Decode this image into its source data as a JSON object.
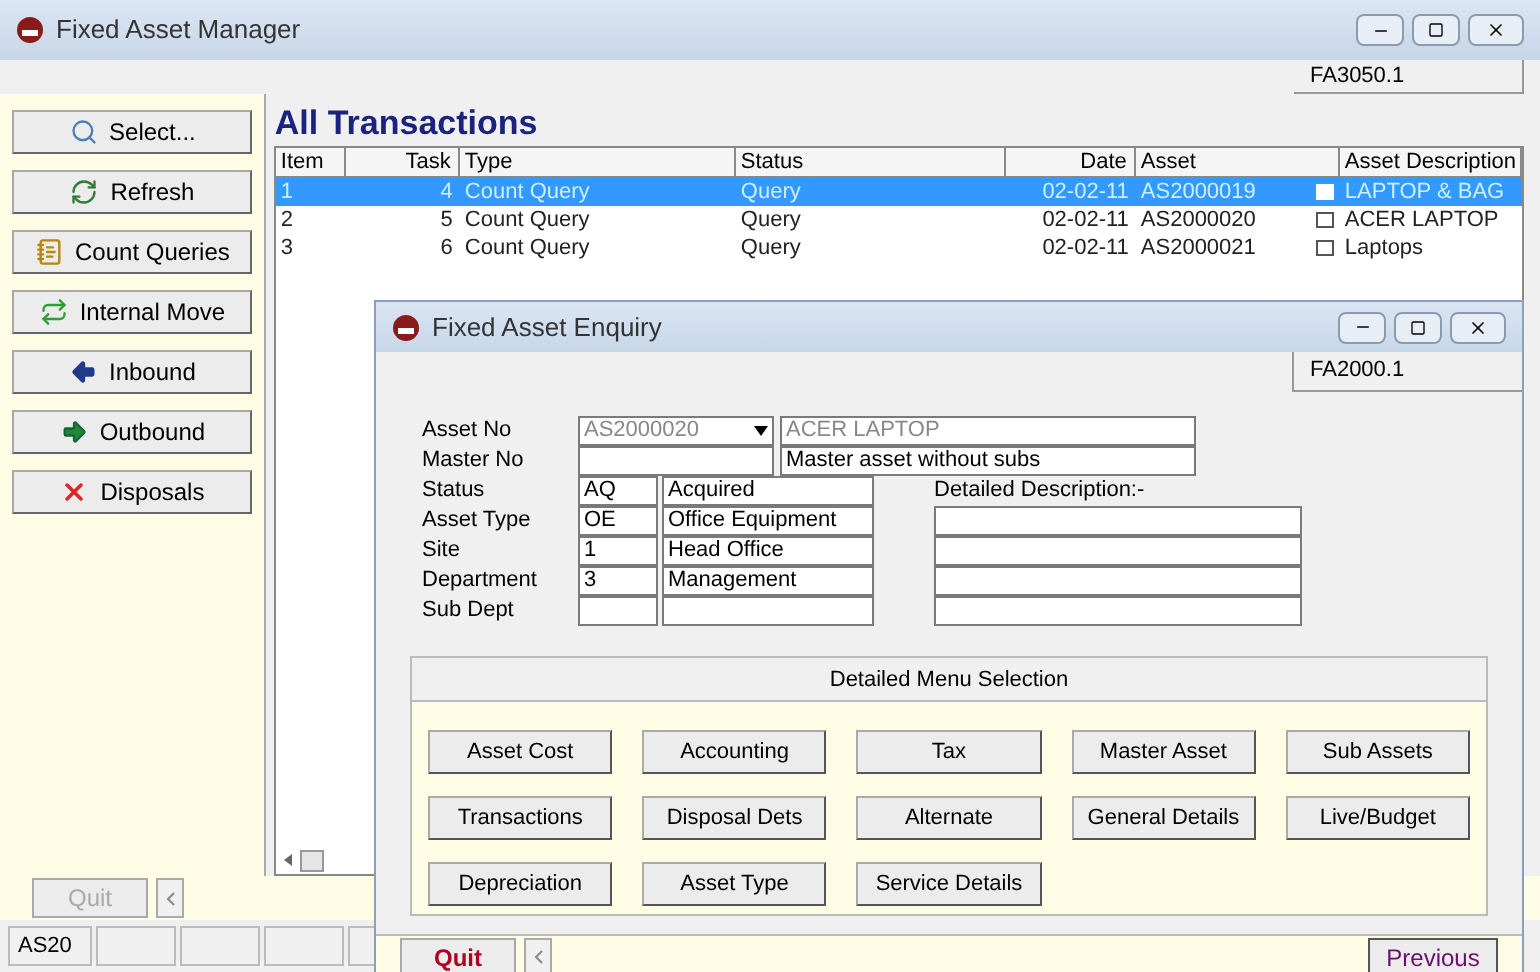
{
  "window": {
    "title": "Fixed Asset Manager",
    "code": "FA3050.1"
  },
  "sidebar": {
    "buttons": [
      {
        "label": "Select..."
      },
      {
        "label": "Refresh"
      },
      {
        "label": "Count Queries"
      },
      {
        "label": "Internal Move"
      },
      {
        "label": "Inbound"
      },
      {
        "label": "Outbound"
      },
      {
        "label": "Disposals"
      }
    ]
  },
  "heading": "All Transactions",
  "table": {
    "columns": [
      "Item",
      "Task",
      "Type",
      "Status",
      "Date",
      "Asset",
      "Asset Description"
    ],
    "rows": [
      {
        "item": "1",
        "task": "4",
        "type": "Count Query",
        "status": "Query",
        "date": "02-02-11",
        "asset": "AS2000019",
        "description": "LAPTOP & BAG",
        "selected": true
      },
      {
        "item": "2",
        "task": "5",
        "type": "Count Query",
        "status": "Query",
        "date": "02-02-11",
        "asset": "AS2000020",
        "description": "ACER LAPTOP",
        "selected": false
      },
      {
        "item": "3",
        "task": "6",
        "type": "Count Query",
        "status": "Query",
        "date": "02-02-11",
        "asset": "AS2000021",
        "description": "Laptops",
        "selected": false
      }
    ]
  },
  "bottom_bar": {
    "quit": {
      "label": "Quit",
      "disabled": true
    }
  },
  "status_bar": [
    "AS20"
  ],
  "dialog": {
    "title": "Fixed Asset Enquiry",
    "code": "FA2000.1",
    "asset_no": {
      "label": "Asset No",
      "value": "AS2000020",
      "description": "ACER LAPTOP"
    },
    "master_no": {
      "label": "Master No",
      "description": "Master asset without subs"
    },
    "fields": [
      {
        "label": "Status",
        "code": "AQ",
        "value": "Acquired"
      },
      {
        "label": "Asset Type",
        "code": "OE",
        "value": "Office Equipment"
      },
      {
        "label": "Site",
        "code": "1",
        "value": "Head Office"
      },
      {
        "label": "Department",
        "code": "3",
        "value": "Management"
      },
      {
        "label": "Sub Dept"
      }
    ],
    "detailed_description_label": "Detailed Description:-",
    "menu_title": "Detailed Menu Selection",
    "menu_buttons": [
      "Asset Cost",
      "Accounting",
      "Tax",
      "Master Asset",
      "Sub Assets",
      "Transactions",
      "Disposal Dets",
      "Alternate",
      "General Details",
      "Live/Budget",
      "Depreciation",
      "Asset Type",
      "Service Details"
    ],
    "quit": {
      "label": "Quit",
      "disabled": false
    },
    "previous": "Previous"
  }
}
